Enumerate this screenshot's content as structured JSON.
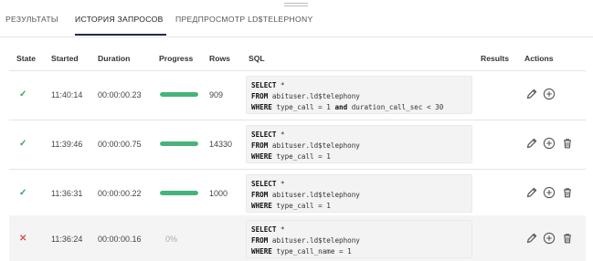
{
  "tabs": [
    {
      "label": "РЕЗУЛЬТАТЫ"
    },
    {
      "label": "ИСТОРИЯ ЗАПРОСОВ"
    },
    {
      "label": "ПРЕДПРОСМОТР LD$TELEPHONY"
    }
  ],
  "active_tab": 1,
  "columns": {
    "state": "State",
    "started": "Started",
    "duration": "Duration",
    "progress": "Progress",
    "rows": "Rows",
    "sql": "SQL",
    "results": "Results",
    "actions": "Actions"
  },
  "colors": {
    "success": "#3aa35d",
    "error": "#d9534f",
    "progress_fill": "#46b37a",
    "active_tab_underline": "#1f2a44"
  },
  "history": [
    {
      "state_icon": "✓",
      "status": "success",
      "started": "11:40:14",
      "duration": "00:00:00.23",
      "progress_fraction": 1.0,
      "progress_text": "",
      "rows": "909",
      "sql": {
        "l1_kw": "SELECT",
        "l1_rest": " *",
        "l2_kw": "FROM",
        "l2_rest": " abituser.ld$telephony",
        "l3_kw": "WHERE",
        "l3_rest": " type_call = 1 ",
        "l3_kw2": "and",
        "l3_rest2": " duration_call_sec < 30"
      },
      "actions": [
        "pencil-icon",
        "plus-circle-icon"
      ]
    },
    {
      "state_icon": "✓",
      "status": "success",
      "started": "11:39:46",
      "duration": "00:00:00.75",
      "progress_fraction": 1.0,
      "progress_text": "",
      "rows": "14330",
      "sql": {
        "l1_kw": "SELECT",
        "l1_rest": " *",
        "l2_kw": "FROM",
        "l2_rest": " abituser.ld$telephony",
        "l3_kw": "WHERE",
        "l3_rest": " type_call = 1"
      },
      "actions": [
        "pencil-icon",
        "plus-circle-icon",
        "trash-icon"
      ]
    },
    {
      "state_icon": "✓",
      "status": "success",
      "started": "11:36:31",
      "duration": "00:00:00.22",
      "progress_fraction": 1.0,
      "progress_text": "",
      "rows": "1000",
      "sql": {
        "l1_kw": "SELECT",
        "l1_rest": " *",
        "l2_kw": "FROM",
        "l2_rest": " abituser.ld$telephony",
        "l3_kw": "WHERE",
        "l3_rest": " type_call = 1"
      },
      "actions": [
        "pencil-icon",
        "plus-circle-icon",
        "trash-icon"
      ]
    },
    {
      "state_icon": "✕",
      "status": "error",
      "started": "11:36:24",
      "duration": "00:00:00.16",
      "progress_fraction": 0.0,
      "progress_text": "0%",
      "rows": "",
      "sql": {
        "l1_kw": "SELECT",
        "l1_rest": " *",
        "l2_kw": "FROM",
        "l2_rest": " abituser.ld$telephony",
        "l3_kw": "WHERE",
        "l3_rest": " type_call_name = 1"
      },
      "actions": [
        "pencil-icon",
        "plus-circle-icon",
        "trash-icon"
      ]
    }
  ]
}
